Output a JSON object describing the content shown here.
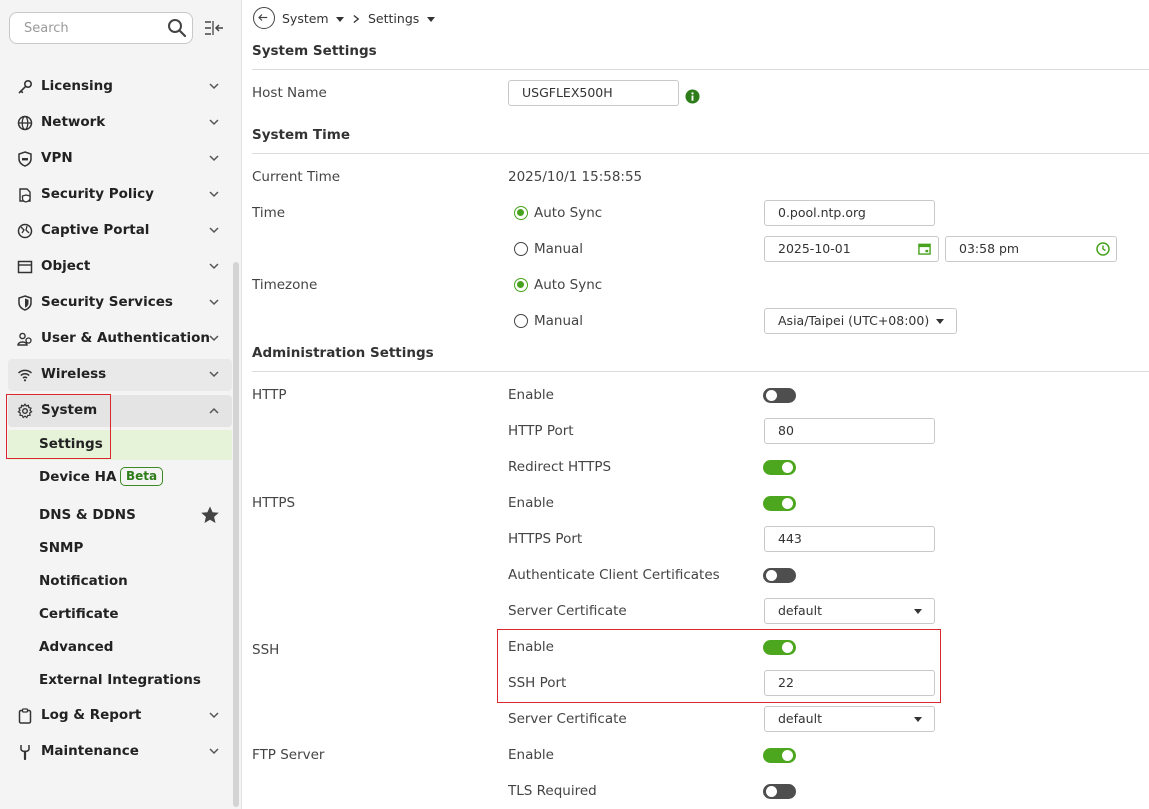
{
  "sidebar": {
    "search_placeholder": "Search",
    "menu": [
      {
        "label": "Licensing",
        "icon": "key-icon"
      },
      {
        "label": "Network",
        "icon": "globe-icon"
      },
      {
        "label": "VPN",
        "icon": "shield-vpn-icon"
      },
      {
        "label": "Security Policy",
        "icon": "security-policy-icon"
      },
      {
        "label": "Captive Portal",
        "icon": "captive-portal-icon"
      },
      {
        "label": "Object",
        "icon": "object-icon"
      },
      {
        "label": "Security Services",
        "icon": "security-services-icon"
      },
      {
        "label": "User & Authentication",
        "icon": "users-icon"
      },
      {
        "label": "Wireless",
        "icon": "wifi-icon"
      },
      {
        "label": "System",
        "icon": "gear-icon"
      },
      {
        "label": "Log & Report",
        "icon": "clipboard-icon"
      },
      {
        "label": "Maintenance",
        "icon": "wrench-icon"
      }
    ],
    "system_submenu": [
      {
        "label": "Settings"
      },
      {
        "label": "Device HA",
        "badge": "Beta"
      },
      {
        "label": "DNS & DDNS"
      },
      {
        "label": "SNMP"
      },
      {
        "label": "Notification"
      },
      {
        "label": "Certificate"
      },
      {
        "label": "Advanced"
      },
      {
        "label": "External Integrations"
      }
    ]
  },
  "breadcrumb": {
    "item1": "System",
    "item2": "Settings"
  },
  "system_settings": {
    "title": "System Settings",
    "host_name_label": "Host Name",
    "host_name_value": "USGFLEX500H"
  },
  "system_time": {
    "title": "System Time",
    "current_time_label": "Current Time",
    "current_time_value": "2025/10/1 15:58:55",
    "time_label": "Time",
    "time_auto_sync": "Auto Sync",
    "time_manual": "Manual",
    "ntp_server": "0.pool.ntp.org",
    "manual_date": "2025-10-01",
    "manual_time": "03:58 pm",
    "timezone_label": "Timezone",
    "tz_auto_sync": "Auto Sync",
    "tz_manual": "Manual",
    "timezone_value": "Asia/Taipei (UTC+08:00)"
  },
  "admin": {
    "title": "Administration Settings",
    "http_label": "HTTP",
    "http_enable": "Enable",
    "http_port_label": "HTTP Port",
    "http_port": "80",
    "redirect_https": "Redirect HTTPS",
    "https_label": "HTTPS",
    "https_enable": "Enable",
    "https_port_label": "HTTPS Port",
    "https_port": "443",
    "auth_client_certs": "Authenticate Client Certificates",
    "https_server_cert_label": "Server Certificate",
    "https_server_cert": "default",
    "ssh_label": "SSH",
    "ssh_enable": "Enable",
    "ssh_port_label": "SSH Port",
    "ssh_port": "22",
    "ssh_server_cert_label": "Server Certificate",
    "ssh_server_cert": "default",
    "ftp_label": "FTP Server",
    "ftp_enable": "Enable",
    "tls_required": "TLS Required"
  },
  "colors": {
    "accent_green": "#4da71e",
    "highlight_red": "#d9272e",
    "active_bg": "#e6f3d8"
  }
}
